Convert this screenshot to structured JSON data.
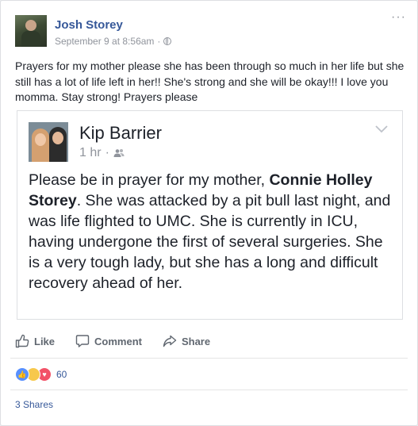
{
  "post": {
    "author": "Josh Storey",
    "timestamp": "September 9 at 8:56am",
    "separator": "·",
    "more_label": "···",
    "text": "Prayers for my mother please she has been through so much in her life but she still has a lot of life left in her!! She's strong and she will be okay!!! I love you momma. Stay strong! Prayers please"
  },
  "shared": {
    "author": "Kip Barrier",
    "time": "1 hr",
    "separator": "·",
    "text_before": "Please be in prayer for my mother, ",
    "text_bold": "Connie Holley Storey",
    "text_after": ". She was attacked by a pit bull last night, and was life flighted to UMC. She is currently in ICU, having undergone the first of several surgeries. She is a very tough lady, but she has a long and difficult recovery ahead of her."
  },
  "actions": {
    "like": "Like",
    "comment": "Comment",
    "share": "Share"
  },
  "reactions": {
    "types": [
      "like",
      "sad",
      "love"
    ],
    "count": "60"
  },
  "shares": "3 Shares",
  "colors": {
    "link": "#365899",
    "meta": "#90949c",
    "text": "#1d2129",
    "action": "#606770",
    "like_reaction": "#5890ff",
    "sad_reaction": "#f7c84c",
    "love_reaction": "#f25268"
  }
}
